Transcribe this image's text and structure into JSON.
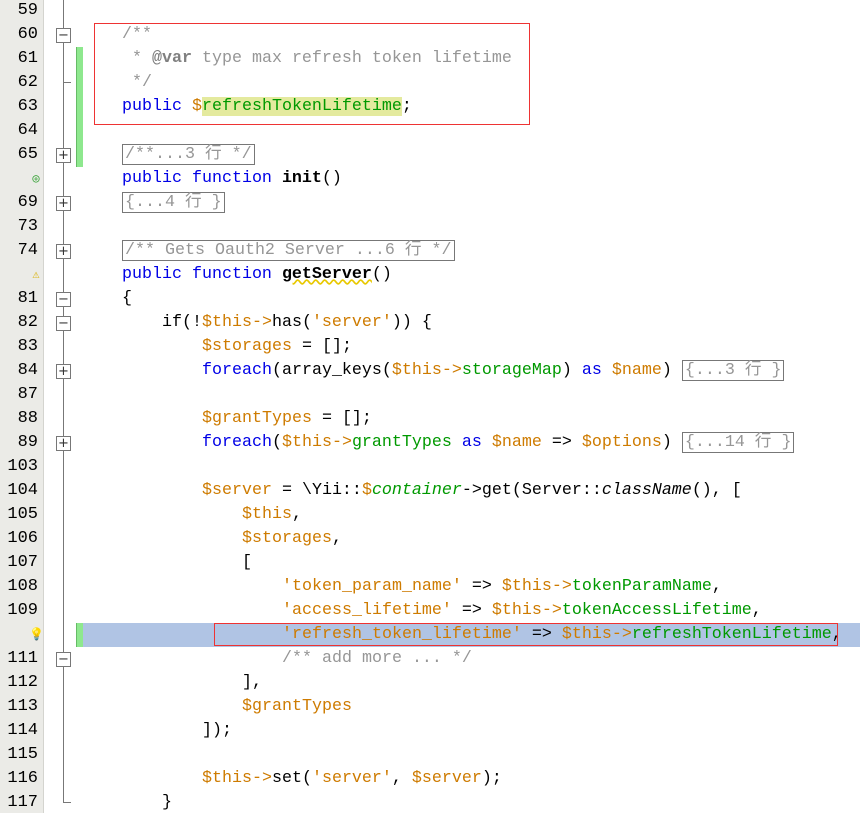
{
  "editor": {
    "lines": [
      {
        "num": "59",
        "tokens": []
      },
      {
        "num": "60",
        "fold": "minus",
        "indent": 1,
        "tokens": [
          {
            "t": "/**",
            "c": "c"
          }
        ]
      },
      {
        "num": "61",
        "chg": true,
        "indent": 1,
        "tokens": [
          {
            "t": " * ",
            "c": "c"
          },
          {
            "t": "@var",
            "c": "cb"
          },
          {
            "t": " type max refresh token lifetime",
            "c": "c"
          }
        ]
      },
      {
        "num": "62",
        "chg": true,
        "tick": true,
        "indent": 1,
        "tokens": [
          {
            "t": " */",
            "c": "c"
          }
        ]
      },
      {
        "num": "63",
        "chg": true,
        "indent": 1,
        "tokens": [
          {
            "t": "public",
            "c": "k"
          },
          {
            "t": " "
          },
          {
            "t": "$",
            "c": "v"
          },
          {
            "t": "refreshTokenLifetime",
            "c": "p mark"
          },
          {
            "t": ";"
          }
        ]
      },
      {
        "num": "64",
        "chg": true,
        "tokens": []
      },
      {
        "num": "65",
        "chg": true,
        "fold": "plus",
        "indent": 1,
        "tokens": [
          {
            "t": "/**...3 行 */",
            "c": "c box"
          }
        ]
      },
      {
        "num": "",
        "icon": "override-icon",
        "indent": 1,
        "tokens": [
          {
            "t": "public function",
            "c": "k"
          },
          {
            "t": " "
          },
          {
            "t": "init",
            "c": "b"
          },
          {
            "t": "()"
          }
        ]
      },
      {
        "num": "69",
        "fold": "plus",
        "indent": 1,
        "tokens": [
          {
            "t": "{...4 行 }",
            "c": "c box"
          }
        ]
      },
      {
        "num": "73",
        "tokens": []
      },
      {
        "num": "74",
        "fold": "plus",
        "indent": 1,
        "tokens": [
          {
            "t": "/** Gets Oauth2 Server ...6 行 */",
            "c": "c box"
          }
        ]
      },
      {
        "num": "",
        "icon": "warning-icon",
        "indent": 1,
        "tokens": [
          {
            "t": "public function",
            "c": "k"
          },
          {
            "t": " "
          },
          {
            "t": "getServer",
            "c": "b sq"
          },
          {
            "t": "()"
          }
        ]
      },
      {
        "num": "81",
        "fold": "minus",
        "indent": 1,
        "tokens": [
          {
            "t": "{"
          }
        ]
      },
      {
        "num": "82",
        "fold": "minus",
        "indent": 2,
        "tokens": [
          {
            "t": "if(!"
          },
          {
            "t": "$this->",
            "c": "v"
          },
          {
            "t": "has("
          },
          {
            "t": "'server'",
            "c": "s"
          },
          {
            "t": ")) {"
          }
        ]
      },
      {
        "num": "83",
        "indent": 3,
        "tokens": [
          {
            "t": "$storages",
            "c": "v"
          },
          {
            "t": " = [];"
          }
        ]
      },
      {
        "num": "84",
        "fold": "plus",
        "indent": 3,
        "tokens": [
          {
            "t": "foreach",
            "c": "k"
          },
          {
            "t": "(array_keys("
          },
          {
            "t": "$this->",
            "c": "v"
          },
          {
            "t": "storageMap",
            "c": "p"
          },
          {
            "t": ") "
          },
          {
            "t": "as",
            "c": "k"
          },
          {
            "t": " "
          },
          {
            "t": "$name",
            "c": "v"
          },
          {
            "t": ") "
          },
          {
            "t": "{...3 行 }",
            "c": "c box"
          }
        ]
      },
      {
        "num": "87",
        "tokens": []
      },
      {
        "num": "88",
        "indent": 3,
        "tokens": [
          {
            "t": "$grantTypes",
            "c": "v"
          },
          {
            "t": " = [];"
          }
        ]
      },
      {
        "num": "89",
        "fold": "plus",
        "indent": 3,
        "tokens": [
          {
            "t": "foreach",
            "c": "k"
          },
          {
            "t": "("
          },
          {
            "t": "$this->",
            "c": "v"
          },
          {
            "t": "grantTypes",
            "c": "p"
          },
          {
            "t": " "
          },
          {
            "t": "as",
            "c": "k"
          },
          {
            "t": " "
          },
          {
            "t": "$name",
            "c": "v"
          },
          {
            "t": " => "
          },
          {
            "t": "$options",
            "c": "v"
          },
          {
            "t": ") "
          },
          {
            "t": "{...14 行 }",
            "c": "c box"
          }
        ]
      },
      {
        "num": "103",
        "tokens": []
      },
      {
        "num": "104",
        "indent": 3,
        "tokens": [
          {
            "t": "$server",
            "c": "v"
          },
          {
            "t": " = \\Yii::"
          },
          {
            "t": "$",
            "c": "v"
          },
          {
            "t": "container",
            "c": "p i"
          },
          {
            "t": "->get(Server::"
          },
          {
            "t": "className",
            "c": "i"
          },
          {
            "t": "(), ["
          }
        ]
      },
      {
        "num": "105",
        "indent": 4,
        "tokens": [
          {
            "t": "$this",
            "c": "v"
          },
          {
            "t": ","
          }
        ]
      },
      {
        "num": "106",
        "indent": 4,
        "tokens": [
          {
            "t": "$storages",
            "c": "v"
          },
          {
            "t": ","
          }
        ]
      },
      {
        "num": "107",
        "indent": 4,
        "tokens": [
          {
            "t": "["
          }
        ]
      },
      {
        "num": "108",
        "indent": 5,
        "tokens": [
          {
            "t": "'token_param_name'",
            "c": "s"
          },
          {
            "t": " => "
          },
          {
            "t": "$this->",
            "c": "v"
          },
          {
            "t": "tokenParamName",
            "c": "p"
          },
          {
            "t": ","
          }
        ]
      },
      {
        "num": "109",
        "indent": 5,
        "tokens": [
          {
            "t": "'access_lifetime'",
            "c": "s"
          },
          {
            "t": " => "
          },
          {
            "t": "$this->",
            "c": "v"
          },
          {
            "t": "tokenAccessLifetime",
            "c": "p"
          },
          {
            "t": ","
          }
        ]
      },
      {
        "num": "",
        "icon": "bulb-icon",
        "chg": true,
        "current": true,
        "indent": 5,
        "tokens": [
          {
            "t": "'refresh_token_lifetime'",
            "c": "s"
          },
          {
            "t": " => "
          },
          {
            "t": "$this->",
            "c": "v"
          },
          {
            "t": "refreshTokenLifetime",
            "c": "p"
          },
          {
            "t": ","
          }
        ]
      },
      {
        "num": "111",
        "fold": "minus",
        "indent": 5,
        "tokens": [
          {
            "t": "/** add more ... */",
            "c": "c"
          }
        ]
      },
      {
        "num": "112",
        "indent": 4,
        "tokens": [
          {
            "t": "],"
          }
        ]
      },
      {
        "num": "113",
        "indent": 4,
        "tokens": [
          {
            "t": "$grantTypes",
            "c": "v"
          }
        ]
      },
      {
        "num": "114",
        "indent": 3,
        "tokens": [
          {
            "t": "]);"
          }
        ]
      },
      {
        "num": "115",
        "tokens": []
      },
      {
        "num": "116",
        "indent": 3,
        "tokens": [
          {
            "t": "$this->",
            "c": "v"
          },
          {
            "t": "set("
          },
          {
            "t": "'server'",
            "c": "s"
          },
          {
            "t": ", "
          },
          {
            "t": "$server",
            "c": "v"
          },
          {
            "t": ");"
          }
        ]
      },
      {
        "num": "117",
        "tick": true,
        "indent": 2,
        "tokens": [
          {
            "t": "}"
          }
        ]
      }
    ],
    "colors": {
      "keyword": "#0000e6",
      "variable": "#ce7b00",
      "property": "#009900",
      "comment": "#969696",
      "current_line": "#b0c4e4",
      "change_bar": "#8ee88e",
      "annotation_box": "#e33333"
    }
  }
}
